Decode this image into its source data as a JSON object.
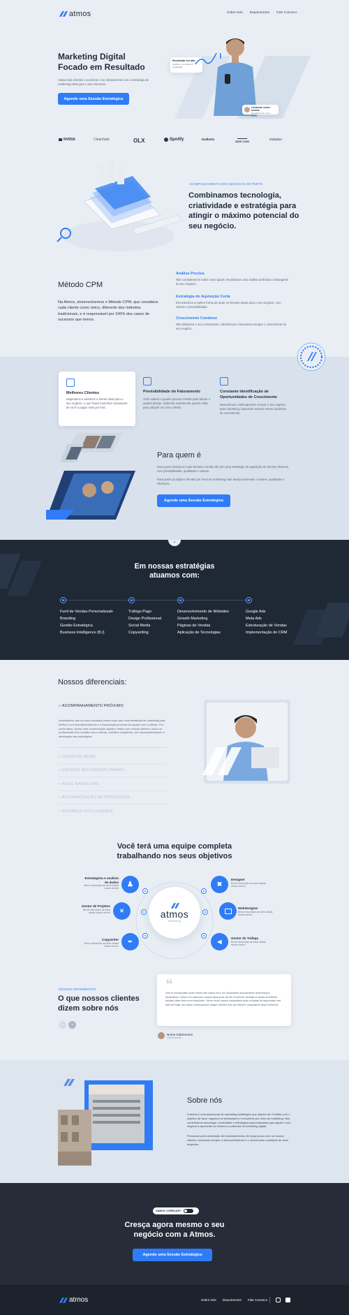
{
  "header": {
    "logo_text": "atmos",
    "logo_sub": "marketing",
    "nav": [
      "Sobre Nós",
      "Depoimentos",
      "Fale Conosco"
    ]
  },
  "hero": {
    "title_line1": "Marketing Digital",
    "title_line2": "Focado em Resultado",
    "subtitle": "Atraia mais clientes e aumente o seu faturamento com a estratégia de marketing ideal para o seu momento.",
    "cta": "Agende uma Sessão Estratégica",
    "card_top_title": "Resultado em alta",
    "card_top_text": "Gestão e as melhores estratégias.",
    "card_bottom_title": "Lembrete como ouvido",
    "card_bottom_text": "Resultado com novo cliente."
  },
  "partners": [
    "NVIDIA",
    "CleanSale",
    "OLX",
    "Spotify",
    "Kwikstix",
    "SAINT LOUIS",
    "Multiplan"
  ],
  "about_intro": {
    "kicker": "ACOMPANHAMENTO DOS NEGÓCIOS DE PERTO",
    "title": "Combinamos tecnologia, criatividade e estratégia para atingir o máximo potencial do seu negócio."
  },
  "cpm": {
    "title": "Método CPM",
    "text": "Na Atmos, desenvolvemos o Método CPM, que considera cada cliente como único, diferente dos métodos tradicionais, e é responsável por 100% dos cases de sucessos que temos.",
    "features": [
      {
        "title": "Análise Precisa",
        "text": "Não consideramos todos como iguais. Realizamos uma análise profunda e abrangente do seu negócio."
      },
      {
        "title": "Estratégia de Aquisição Certa",
        "text": "Encontramos a melhor forma de atrair os clientes ideais para o seu negócio, com volume e previsibilidade."
      },
      {
        "title": "Crescimento Contínuo",
        "text": "Não limitamos o seu crescimento. Otimizamos e buscamos sempre o crescimento do seu negócio."
      }
    ],
    "badge_text": "MARKETING DIGITAL · FOCADO EM RESULTADO ·"
  },
  "benefits": [
    {
      "title": "Melhores Clientes",
      "text": "Mapeamos e atraímos o cliente ideal para o seu negócio, o que ficará mais fácil comprando de você a pagar mais por isso."
    },
    {
      "title": "Previsibilidade do Faturamento",
      "text": "Você saberá o quanto precisa investir para faturar o quanto deseja. Sabendo exatamente quanto volta para adquirir um novo cliente."
    },
    {
      "title": "Constante Identificação de Oportunidades de Crescimento",
      "text": "Buscaremos continuamente crescer o seu negócio para marketing, buscando sempre novos caminhos de crescimento."
    }
  ],
  "for_who": {
    "title": "Para quem é",
    "text1": "Para quem deseja ter mais clientes e ainda não tem uma estratégia de aquisição de clientes eficiente, com previsibilidade, qualidade e volume.",
    "text2": "Para quem já adquire clientes por meio do marketing mas deseja aumentar o volume, qualidade e eficiência.",
    "cta": "Agende uma Sessão Estratégica"
  },
  "strategies": {
    "title_line1": "Em nossas estratégias",
    "title_line2": "atuamos com:",
    "columns": [
      [
        "Funil de Vendas Personalizado",
        "Branding",
        "Gestão Estratégica",
        "Business Intelligence (B.I)"
      ],
      [
        "Tráfego Pago",
        "Design Profissional",
        "Social Media",
        "Copywriting"
      ],
      [
        "Desenvolvimento de Websites",
        "Growth Marketing",
        "Páginas de Vendas",
        "Aplicação de Tecnologias"
      ],
      [
        "Google Ads",
        "Meta Ads",
        "Estruturação de Vendas",
        "Implementação de CRM"
      ]
    ]
  },
  "differentials": {
    "title": "Nossos diferenciais:",
    "active_item": "ACOMPANHAMENTO PRÓXIMO",
    "active_text": "Acreditamos que um dos principais pontos para que uma estratégia de marketing seja efetiva é um acompanhamento e comunicação próxima da equipe com o cliente. Por conta disso, temos uma comunicação rápida e direta com nossos clientes, todos os profissionais têm contato com o cliente, reuniões completas, com acompanhamento e otimização das estratégias.",
    "items": [
      "CREATIVE WORK",
      "EQUIPES MULTIDISCIPLINARES",
      "AGILE MARKETING",
      "AUTOMATIZAÇÃO DE PROCESSOS",
      "BUSINESS INTELLIGENCE"
    ]
  },
  "team": {
    "title_line1": "Você terá uma equipe completa",
    "title_line2": "trabalhando nos seus objetivos",
    "center_logo": "atmos",
    "center_sub": "marketing",
    "roles": [
      {
        "title": "Estrategista e analista de dados",
        "text": "Breve descrição da área citada nesse trecho"
      },
      {
        "title": "Gestor de Projetos",
        "text": "Breve descrição da área citada nesse trecho"
      },
      {
        "title": "Copywriter",
        "text": "Breve descrição da área citada nesse trecho"
      },
      {
        "title": "Designer",
        "text": "Breve descrição da área citada nesse trecho"
      },
      {
        "title": "Webdesigner",
        "text": "Breve descrição da área citada nesse trecho"
      },
      {
        "title": "Gestor de Tráfego",
        "text": "Breve descrição da área citada nesse trecho"
      }
    ]
  },
  "testimonials": {
    "kicker": "NOSSOS DEPOIMENTOS",
    "title_line1": "O que nossos clientes",
    "title_line2": "dizem sobre nós",
    "quote": "Sed ut perspiciatis unde omnis iste natus error sit voluptatem accusantium doloremque laudantium, totam rem aperiam, eaque ipsa quae ab illo inventore veritatis et quasi architecto beatae vitae dicta sunt explicabo. Nemo enim ipsam voluptatem quia voluptas sit aspernatur aut odit aut fugit, sed quia consequuntur magni dolores eos qui ratione voluptatem sequi nesciunt.",
    "author": "Nome Sobrenome",
    "author_role": "Lorem ipsum"
  },
  "about": {
    "title": "Sobre nós",
    "p1": "A Atmos é uma assessoria de marketing estratégico que nasceu em Curitiba com o objetivo de fazer negócios se destacarem e crescerem por meio do marketing. Nós combinamos tecnologia, criatividade e estratégias personalizadas para ajudar o seu negócio a aproveitar ao máximo o potencial do marketing digital.",
    "p2": "Prezamos pela construção de relacionamentos de longo prazo com os nossos clientes, buscando sempre o desenvolvimento e o crescimento constante de seus negócios."
  },
  "final_cta": {
    "pill": "VAMOS COMEÇAR?",
    "title_line1": "Cresça agora mesmo o seu",
    "title_line2": "negócio com a Atmos.",
    "cta": "Agende uma Sessão Estratégica"
  },
  "footer": {
    "logo_text": "atmos",
    "nav": [
      "Sobre Nós",
      "Depoimentos",
      "Fale Conosco"
    ]
  }
}
